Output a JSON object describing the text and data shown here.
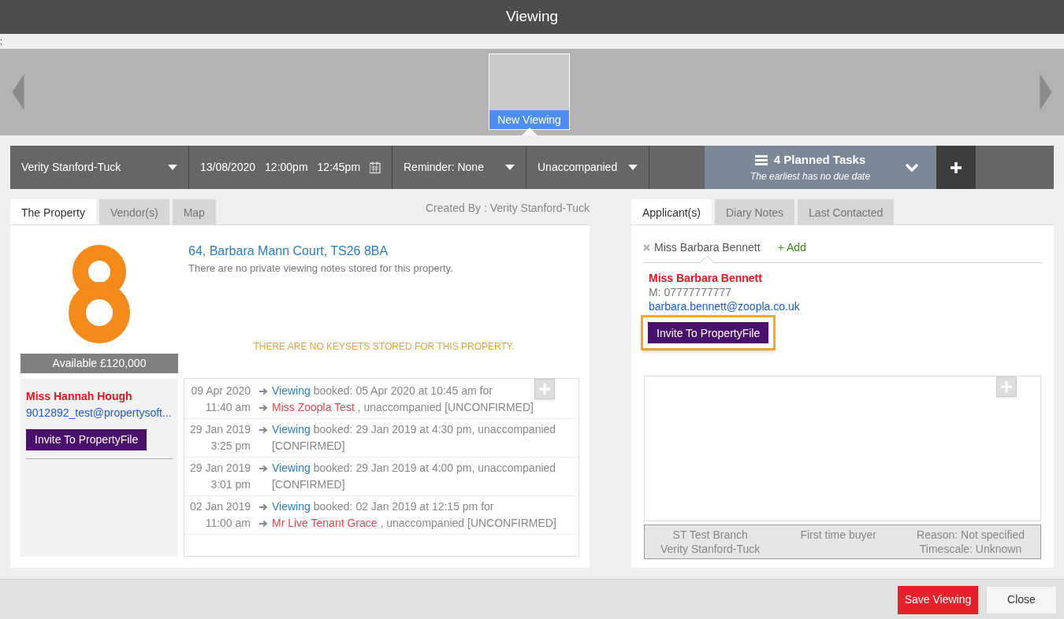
{
  "window": {
    "title": "Viewing"
  },
  "stray_text": ";",
  "carousel": {
    "items": [
      {
        "label": "New Viewing",
        "selected": true
      }
    ]
  },
  "toolbar": {
    "negotiator": "Verity Stanford-Tuck",
    "date": "13/08/2020",
    "start": "12:00pm",
    "end": "12:45pm",
    "reminder": "Reminder: None",
    "accompaniment": "Unaccompanied",
    "tasks": {
      "title": "4 Planned Tasks",
      "subtitle": "The earliest has no due date"
    }
  },
  "left": {
    "tabs": [
      {
        "label": "The Property",
        "selected": true
      },
      {
        "label": "Vendor(s)",
        "selected": false
      },
      {
        "label": "Map",
        "selected": false
      }
    ],
    "created_by": "Created By : Verity Stanford-Tuck",
    "address": "64, Barbara Mann Court, TS26 8BA",
    "notes": "There are no private viewing notes stored for this property.",
    "keysets": "THERE ARE NO KEYSETS STORED FOR THIS PROPERTY.",
    "price": "Available £120,000",
    "vendor": {
      "name": "Miss Hannah Hough",
      "email": "9012892_test@propertysoft...",
      "button": "Invite To PropertyFile"
    },
    "history": [
      {
        "kind": "with_person",
        "date": "09 Apr 2020",
        "time": "11:40 am",
        "link": "Viewing",
        "text": "booked: 05 Apr 2020 at 10:45 am for",
        "person": "Miss Zoopla Test",
        "status": ", unaccompanied [UNCONFIRMED]"
      },
      {
        "kind": "plain",
        "date": "29 Jan 2019",
        "time": "3:25 pm",
        "link": "Viewing",
        "text": "booked: 29 Jan 2019 at 4:30 pm, unaccompanied [CONFIRMED]"
      },
      {
        "kind": "plain",
        "date": "29 Jan 2019",
        "time": "3:01 pm",
        "link": "Viewing",
        "text": "booked: 29 Jan 2019 at 4:00 pm, unaccompanied [CONFIRMED]"
      },
      {
        "kind": "with_person",
        "date": "02 Jan 2019",
        "time": "11:00 am",
        "link": "Viewing",
        "text": "booked: 02 Jan 2019 at 12:15 pm for",
        "person": "Mr Live Tenant Grace",
        "status": ", unaccompanied [UNCONFIRMED]"
      }
    ]
  },
  "right": {
    "tabs": [
      {
        "label": "Applicant(s)",
        "selected": true
      },
      {
        "label": "Diary Notes",
        "selected": false
      },
      {
        "label": "Last Contacted",
        "selected": false
      }
    ],
    "applicant_tabs": [
      {
        "label": "Miss Barbara Bennett",
        "selected": true
      }
    ],
    "add": "+ Add",
    "applicant": {
      "name": "Miss Barbara Bennett",
      "phone": "M: 07777777777",
      "email": "barbara.bennett@zoopla.co.uk",
      "button": "Invite To PropertyFile",
      "highlighted": true
    },
    "footer": {
      "branch": "ST Test Branch",
      "negotiator": "Verity Stanford-Tuck",
      "buyer_type": "First time buyer",
      "reason": "Reason: Not specified",
      "timescale": "Timescale: Unknown"
    }
  },
  "buttons": {
    "save": "Save Viewing",
    "close": "Close"
  }
}
